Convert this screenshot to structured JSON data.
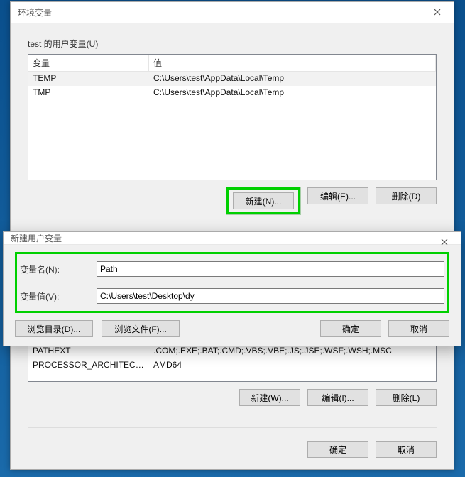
{
  "env_window": {
    "title": "环境变量",
    "user_section_label": "test 的用户变量(U)",
    "columns": {
      "var": "变量",
      "val": "值"
    },
    "user_rows": [
      {
        "var": "TEMP",
        "val": "C:\\Users\\test\\AppData\\Local\\Temp"
      },
      {
        "var": "TMP",
        "val": "C:\\Users\\test\\AppData\\Local\\Temp"
      }
    ],
    "user_buttons": {
      "new": "新建(N)...",
      "edit": "编辑(E)...",
      "delete": "删除(D)"
    },
    "sys_rows": [
      {
        "var": "PATHEXT",
        "val": ".COM;.EXE;.BAT;.CMD;.VBS;.VBE;.JS;.JSE;.WSF;.WSH;.MSC"
      },
      {
        "var": "PROCESSOR_ARCHITECT...",
        "val": "AMD64"
      }
    ],
    "sys_buttons": {
      "new": "新建(W)...",
      "edit": "编辑(I)...",
      "delete": "删除(L)"
    },
    "footer": {
      "ok": "确定",
      "cancel": "取消"
    }
  },
  "new_dialog": {
    "title": "新建用户变量",
    "name_label": "变量名(N):",
    "name_value": "Path",
    "value_label": "变量值(V):",
    "value_value": "C:\\Users\\test\\Desktop\\dy",
    "browse_dir": "浏览目录(D)...",
    "browse_file": "浏览文件(F)...",
    "ok": "确定",
    "cancel": "取消"
  }
}
